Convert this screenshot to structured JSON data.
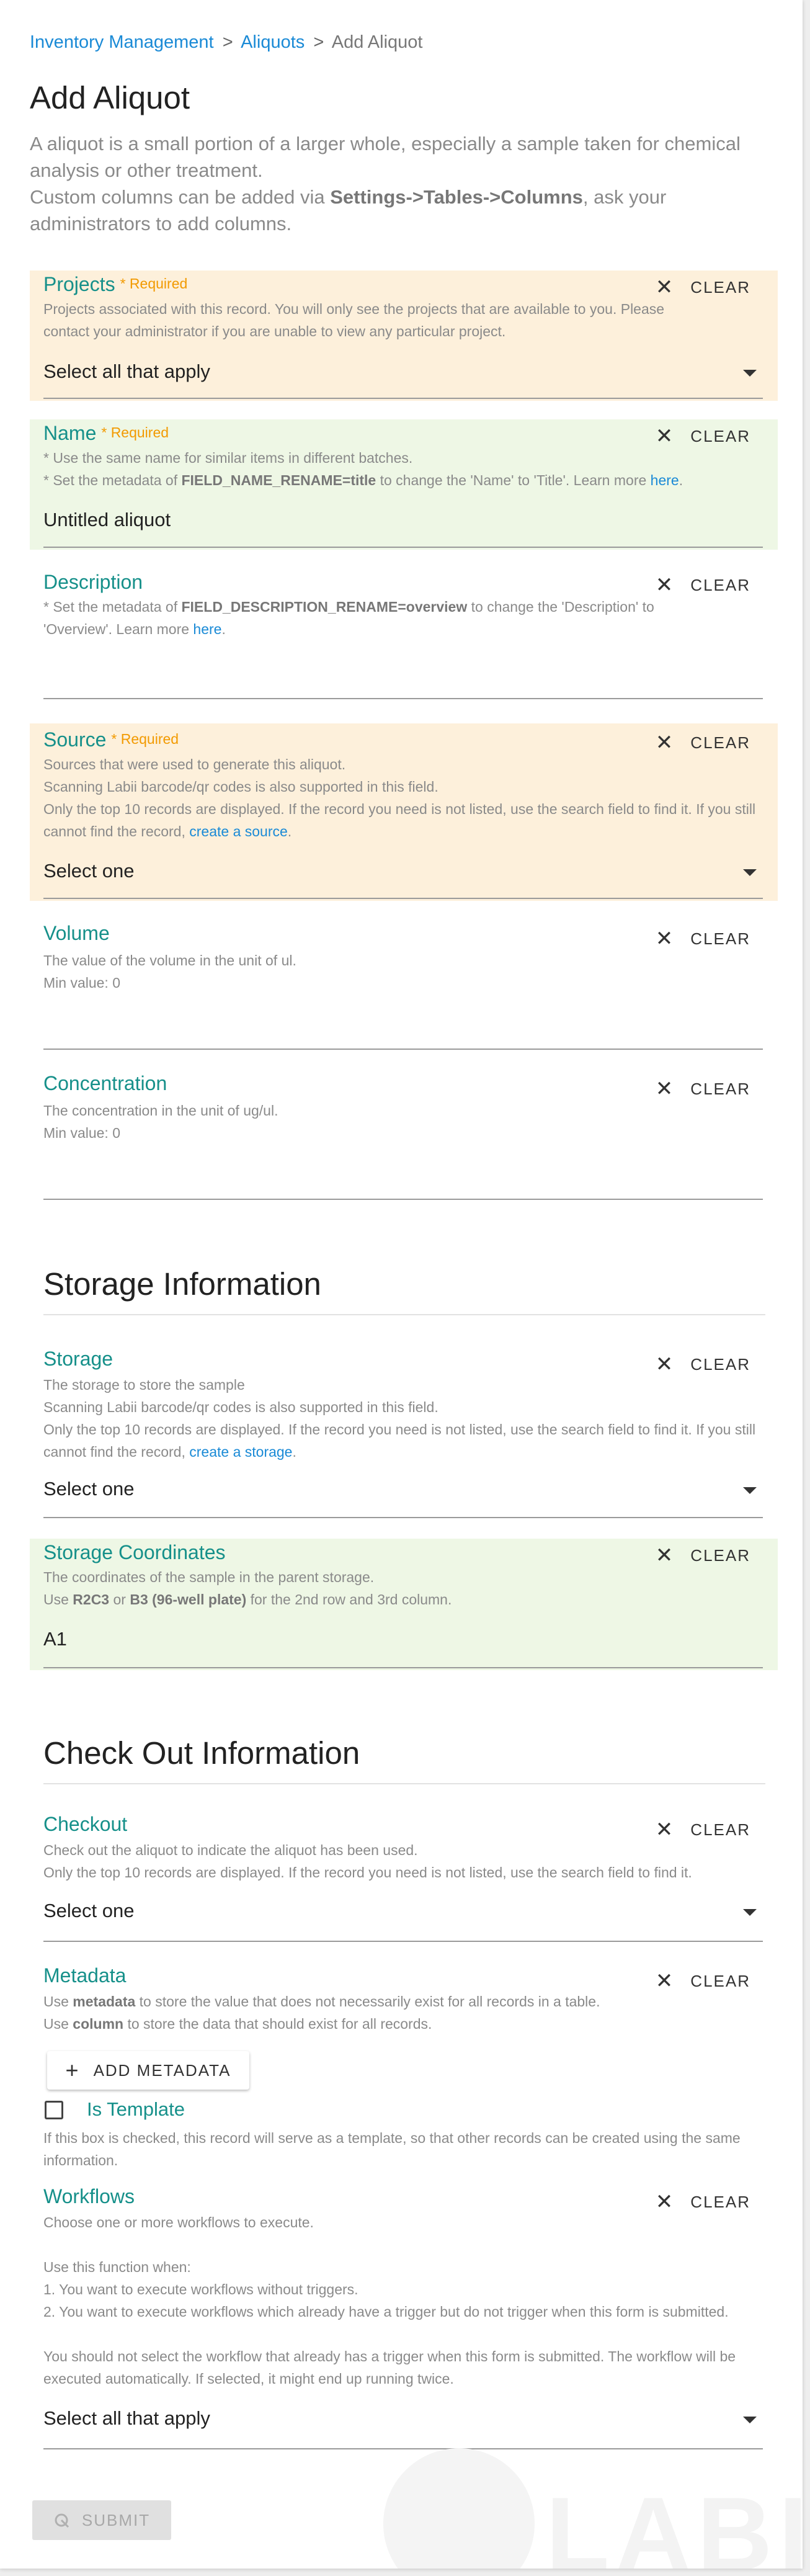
{
  "breadcrumb": {
    "inventory": "Inventory Management",
    "aliquots": "Aliquots",
    "current": "Add Aliquot",
    "sep": ">"
  },
  "page": {
    "title": "Add Aliquot",
    "desc_line1": "A aliquot is a small portion of a larger whole, especially a sample taken for chemical analysis or other treatment.",
    "desc_pre": "Custom columns can be added via ",
    "desc_bold": "Settings->Tables->Columns",
    "desc_post": ", ask your administrators to add columns."
  },
  "common": {
    "clear": "CLEAR",
    "clear_icon": "close-icon",
    "required": "* Required"
  },
  "projects": {
    "label": "Projects",
    "help": "Projects associated with this record. You will only see the projects that are available to you. Please contact your administrator if you are unable to view any particular project.",
    "placeholder": "Select all that apply"
  },
  "name": {
    "label": "Name",
    "help1": "* Use the same name for similar items in different batches.",
    "help2_pre": "* Set the metadata of ",
    "help2_bold": "FIELD_NAME_RENAME=title",
    "help2_mid": " to change the 'Name' to 'Title'. Learn more ",
    "help2_link": "here",
    "help2_end": ".",
    "value": "Untitled aliquot"
  },
  "description": {
    "label": "Description",
    "help_pre": "* Set the metadata of ",
    "help_bold": "FIELD_DESCRIPTION_RENAME=overview",
    "help_mid": " to change the 'Description' to 'Overview'. Learn more ",
    "help_link": "here",
    "help_end": ".",
    "value": ""
  },
  "source": {
    "label": "Source",
    "help1": "Sources that were used to generate this aliquot.",
    "help2": "Scanning Labii barcode/qr codes is also supported in this field.",
    "help3_pre": "Only the top 10 records are displayed. If the record you need is not listed, use the search field to find it. If you still cannot find the record, ",
    "help3_link": "create a source",
    "help3_end": ".",
    "placeholder": "Select one"
  },
  "volume": {
    "label": "Volume",
    "help1": "The value of the volume in the unit of ul.",
    "help2": "Min value: 0",
    "value": ""
  },
  "concentration": {
    "label": "Concentration",
    "help1": "The concentration in the unit of ug/ul.",
    "help2": "Min value: 0",
    "value": ""
  },
  "storage_section": {
    "title": "Storage Information"
  },
  "storage": {
    "label": "Storage",
    "help1": "The storage to store the sample",
    "help2": "Scanning Labii barcode/qr codes is also supported in this field.",
    "help3_pre": "Only the top 10 records are displayed. If the record you need is not listed, use the search field to find it. If you still cannot find the record, ",
    "help3_link": "create a storage",
    "help3_end": ".",
    "placeholder": "Select one"
  },
  "coordinates": {
    "label": "Storage Coordinates",
    "help1": "The coordinates of the sample in the parent storage.",
    "help2_pre": "Use ",
    "help2_b1": "R2C3",
    "help2_mid": " or ",
    "help2_b2": "B3 (96-well plate)",
    "help2_end": " for the 2nd row and 3rd column.",
    "value": "A1"
  },
  "checkout_section": {
    "title": "Check Out Information"
  },
  "checkout": {
    "label": "Checkout",
    "help1": "Check out the aliquot to indicate the aliquot has been used.",
    "help2": "Only the top 10 records are displayed. If the record you need is not listed, use the search field to find it.",
    "placeholder": "Select one"
  },
  "metadata": {
    "label": "Metadata",
    "help1_pre": "Use ",
    "help1_b": "metadata",
    "help1_post": " to store the value that does not necessarily exist for all records in a table.",
    "help2_pre": "Use ",
    "help2_b": "column",
    "help2_post": " to store the data that should exist for all records.",
    "add_button": "ADD METADATA",
    "add_icon": "plus-icon"
  },
  "template": {
    "label": "Is Template",
    "checked": false,
    "help": "If this box is checked, this record will serve as a template, so that other records can be created using the same information."
  },
  "workflows": {
    "label": "Workflows",
    "help1": "Choose one or more workflows to execute.",
    "help2": "Use this function when:",
    "help3": "1. You want to execute workflows without triggers.",
    "help4": "2. You want to execute workflows which already have a trigger but do not trigger when this form is submitted.",
    "help5": "You should not select the workflow that already has a trigger when this form is submitted. The workflow will be executed automatically. If selected, it might end up running twice.",
    "placeholder": "Select all that apply"
  },
  "submit": {
    "label": "SUBMIT",
    "icon": "submit-icon"
  },
  "watermark": {
    "text": "LABII"
  }
}
